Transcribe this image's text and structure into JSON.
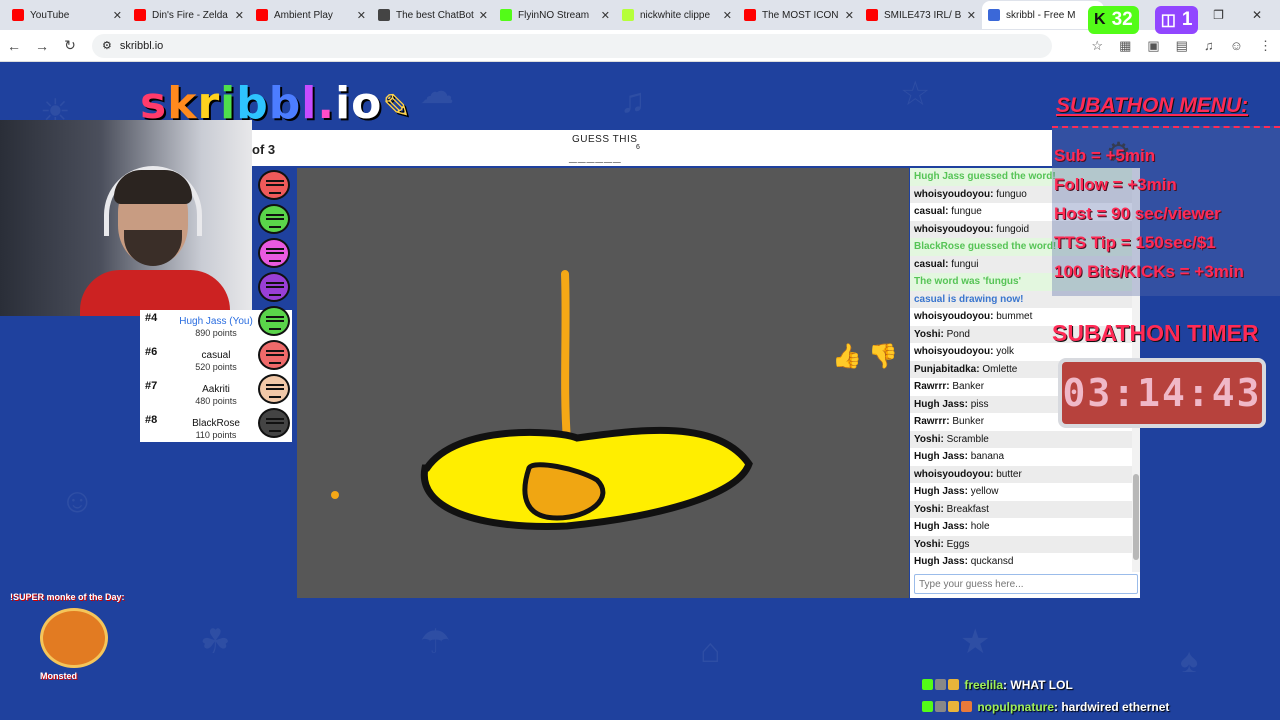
{
  "browser": {
    "tabs": [
      {
        "label": "YouTube",
        "color": "#ff0000"
      },
      {
        "label": "Din's Fire - Zelda",
        "color": "#ff0000"
      },
      {
        "label": "Ambient Play",
        "color": "#ff0000"
      },
      {
        "label": "The best ChatBot",
        "color": "#444444"
      },
      {
        "label": "FlyinNO Stream",
        "color": "#53fc18"
      },
      {
        "label": "nickwhite clippe",
        "color": "#b6ff3a"
      },
      {
        "label": "The MOST ICON",
        "color": "#ff0000"
      },
      {
        "label": "SMILE473 IRL/ B",
        "color": "#ff0000"
      },
      {
        "label": "skribbl - Free M",
        "color": "#3b68d8"
      }
    ],
    "url": "skribbl.io"
  },
  "stream_stats": {
    "kick_viewers": "32",
    "twitch_viewers": "1"
  },
  "logo": {
    "text": "skribbl.io"
  },
  "game": {
    "round": "of 3",
    "guess_label": "GUESS THIS",
    "word_hint": "______",
    "word_length": "6"
  },
  "players": [
    {
      "rank": "#4",
      "name": "Hugh Jass (You)",
      "points": "890 points",
      "you": true
    },
    {
      "rank": "#6",
      "name": "casual",
      "points": "520 points"
    },
    {
      "rank": "#7",
      "name": "Aakriti",
      "points": "480 points"
    },
    {
      "rank": "#8",
      "name": "BlackRose",
      "points": "110 points"
    }
  ],
  "chat": {
    "messages": [
      {
        "type": "green",
        "text": "Hugh Jass guessed the word!"
      },
      {
        "user": "whoisyoudoyou:",
        "text": "funguo"
      },
      {
        "user": "casual:",
        "text": "fungue"
      },
      {
        "user": "whoisyoudoyou:",
        "text": "fungoid"
      },
      {
        "type": "green",
        "text": "BlackRose guessed the word!"
      },
      {
        "user": "casual:",
        "text": "fungui"
      },
      {
        "type": "green",
        "text": "The word was 'fungus'"
      },
      {
        "type": "blue",
        "text": "casual is drawing now!"
      },
      {
        "user": "whoisyoudoyou:",
        "text": "bummet"
      },
      {
        "user": "Yoshi:",
        "text": "Pond"
      },
      {
        "user": "whoisyoudoyou:",
        "text": "yolk"
      },
      {
        "user": "Punjabitadka:",
        "text": "Omlette"
      },
      {
        "user": "Rawrrr:",
        "text": "Banker"
      },
      {
        "user": "Hugh Jass:",
        "text": "piss"
      },
      {
        "user": "Rawrrr:",
        "text": "Bunker"
      },
      {
        "user": "Yoshi:",
        "text": "Scramble"
      },
      {
        "user": "Hugh Jass:",
        "text": "banana"
      },
      {
        "user": "whoisyoudoyou:",
        "text": "butter"
      },
      {
        "user": "Hugh Jass:",
        "text": "yellow"
      },
      {
        "user": "Yoshi:",
        "text": "Breakfast"
      },
      {
        "user": "Hugh Jass:",
        "text": "hole"
      },
      {
        "user": "Yoshi:",
        "text": "Eggs"
      },
      {
        "user": "Hugh Jass:",
        "text": "quckansd"
      }
    ],
    "input_placeholder": "Type your guess here..."
  },
  "subathon": {
    "title": "SUBATHON MENU:",
    "lines": [
      "Sub = +5min",
      "Follow = +3min",
      "Host = 90 sec/viewer",
      "TTS Tip = 150sec/$1",
      "100 Bits/KICKs = +3min"
    ],
    "timer_title": "SUBATHON TIMER",
    "timer": "03:14:43"
  },
  "monke": {
    "label": "!SUPER monke of the Day:",
    "name": "Monsted"
  },
  "twitch_chat": [
    {
      "user": "freelila",
      "text": ": WHAT LOL"
    },
    {
      "user": "nopulpnature",
      "text": ": hardwired ethernet"
    }
  ]
}
